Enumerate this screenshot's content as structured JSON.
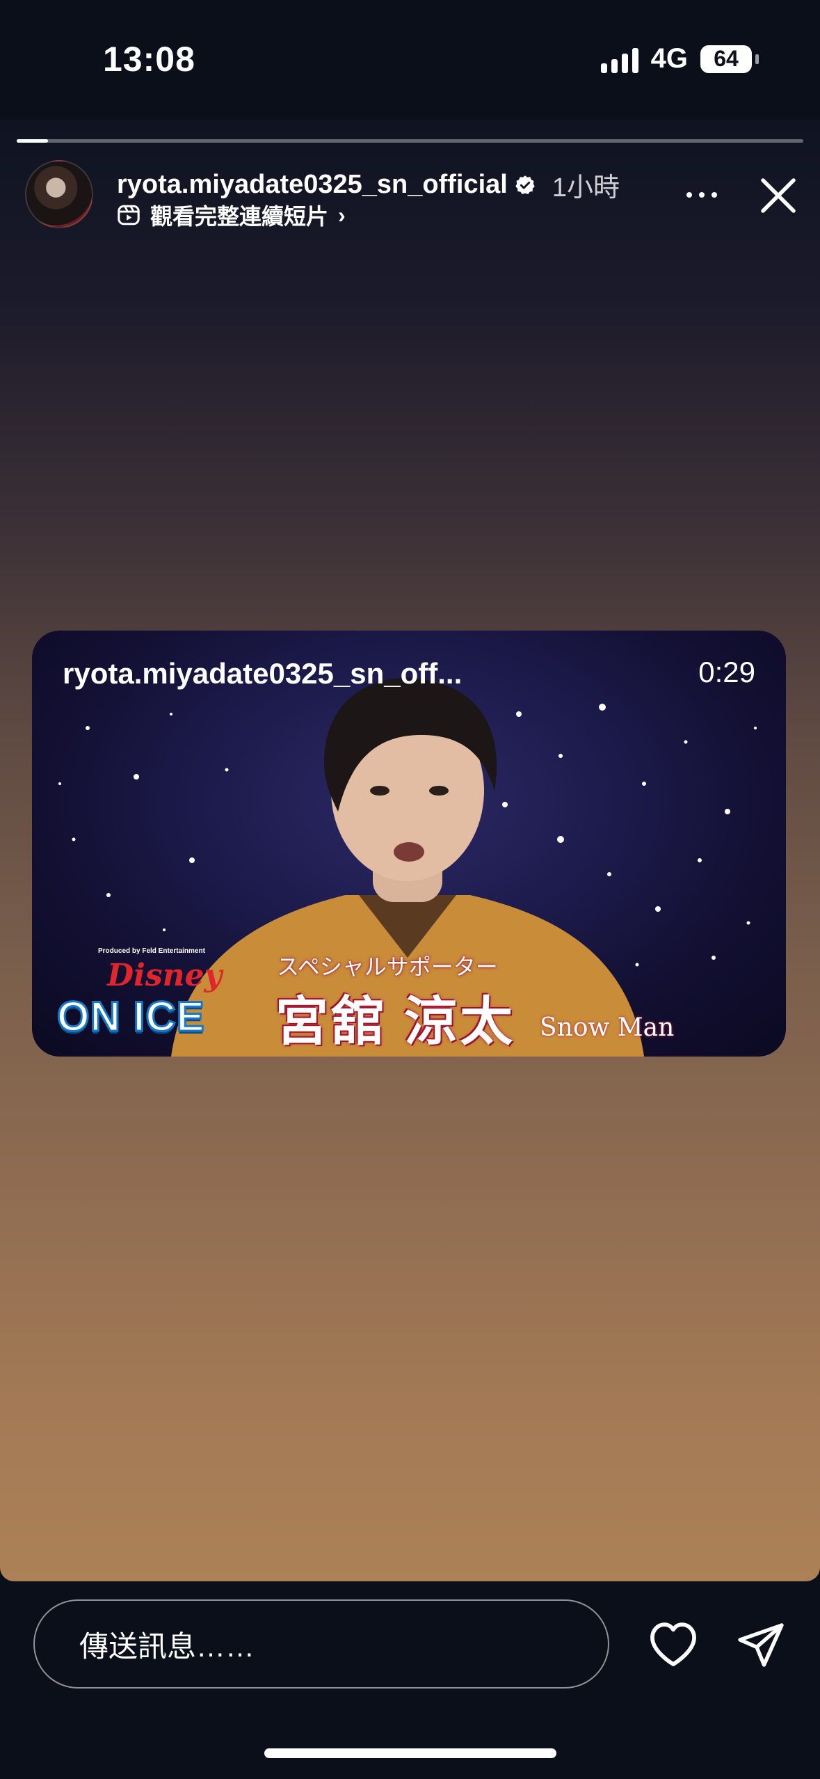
{
  "status_bar": {
    "time": "13:08",
    "network": "4G",
    "battery": "64"
  },
  "story": {
    "progress": 0.04,
    "username": "ryota.miyadate0325_sn_official",
    "time_ago": "1小時",
    "reel_link": "觀看完整連續短片",
    "reel_chevron": "›"
  },
  "video": {
    "overlay_username": "ryota.miyadate0325_sn_off...",
    "duration": "0:29",
    "produced_by": "Produced by Feld Entertainment",
    "logo_disney": "Disney",
    "logo_onice": "ON ICE",
    "subtitle": "スペシャルサポーター",
    "name": "宮舘 涼太",
    "group": "Snow Man"
  },
  "bottom_bar": {
    "message_placeholder": "傳送訊息……"
  },
  "icons": [
    "verified-icon",
    "reels-icon",
    "more-icon",
    "close-icon",
    "heart-icon",
    "send-icon"
  ]
}
